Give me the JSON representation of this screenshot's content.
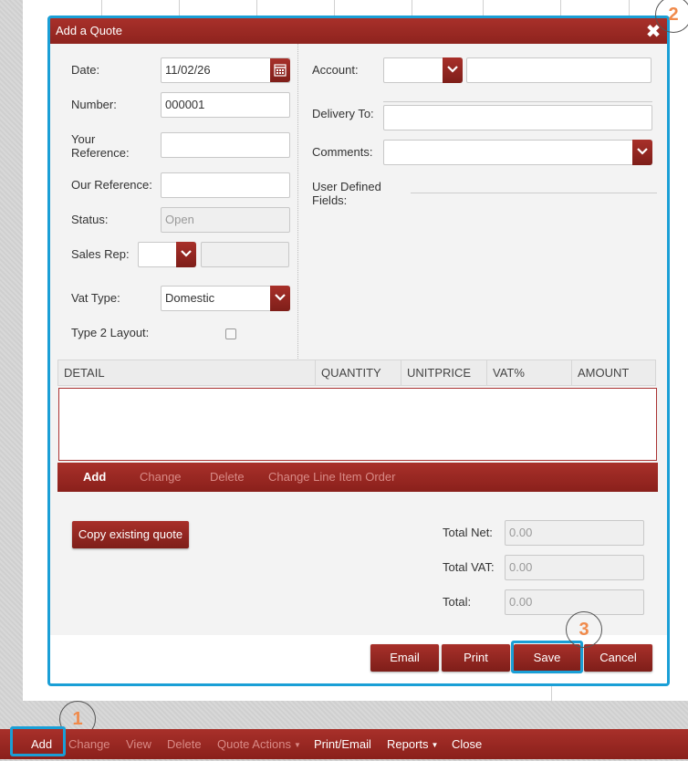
{
  "dialog": {
    "title": "Add a Quote",
    "close_symbol": "✖"
  },
  "form_left": {
    "date_label": "Date:",
    "date_value": "11/02/26",
    "number_label": "Number:",
    "number_value": "000001",
    "your_ref_label_1": "Your",
    "your_ref_label_2": "Reference:",
    "your_ref_value": "",
    "our_ref_label": "Our Reference:",
    "our_ref_value": "",
    "status_label": "Status:",
    "status_value": "Open",
    "sales_rep_label": "Sales Rep:",
    "vat_type_label": "Vat Type:",
    "vat_type_value": "Domestic",
    "type2_label": "Type 2 Layout:"
  },
  "form_right": {
    "account_label": "Account:",
    "delivery_label": "Delivery To:",
    "comments_label": "Comments:",
    "udf_label_1": "User Defined",
    "udf_label_2": "Fields:"
  },
  "table": {
    "columns": [
      "DETAIL",
      "QUANTITY",
      "UNITPRICE",
      "VAT%",
      "AMOUNT"
    ]
  },
  "line_actions": {
    "add": "Add",
    "change": "Change",
    "delete": "Delete",
    "change_order": "Change Line Item Order"
  },
  "totals": {
    "copy_button": "Copy existing quote",
    "total_net_label": "Total Net:",
    "total_net_value": "0.00",
    "total_vat_label": "Total VAT:",
    "total_vat_value": "0.00",
    "total_label": "Total:",
    "total_value": "0.00"
  },
  "footer": {
    "email": "Email",
    "print": "Print",
    "save": "Save",
    "cancel": "Cancel"
  },
  "callouts": {
    "one": "1",
    "two": "2",
    "three": "3"
  },
  "toolbar": {
    "add": "Add",
    "change": "Change",
    "view": "View",
    "delete": "Delete",
    "quote_actions": "Quote Actions",
    "print_email": "Print/Email",
    "reports": "Reports",
    "close": "Close"
  },
  "colors": {
    "accent_red": "#a8302a",
    "highlight_blue": "#1a9fd6",
    "callout_orange": "#f08a4b"
  }
}
